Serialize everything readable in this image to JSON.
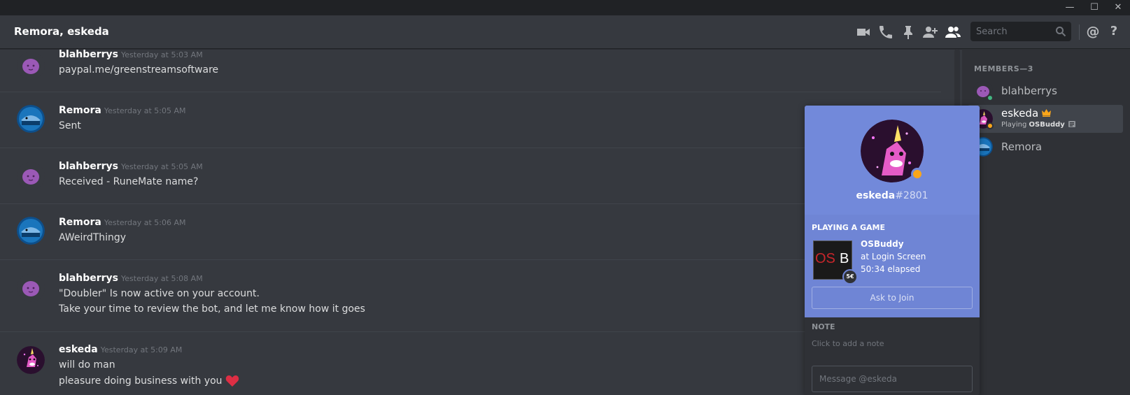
{
  "window": {
    "minimize_glyph": "—",
    "maximize_glyph": "☐",
    "close_glyph": "✕"
  },
  "header": {
    "title": "Remora, eskeda",
    "icons": [
      "video-icon",
      "phone-icon",
      "pin-icon",
      "add-member-icon",
      "members-icon",
      "mention-icon",
      "help-icon"
    ],
    "search_placeholder": "Search",
    "mention_glyph": "@",
    "help_glyph": "?"
  },
  "messages": [
    {
      "author": "blahberrys",
      "timestamp": "Yesterday at 5:03 AM",
      "lines": [
        "paypal.me/greenstreamsoftware"
      ]
    },
    {
      "author": "Remora",
      "timestamp": "Yesterday at 5:05 AM",
      "lines": [
        "Sent"
      ]
    },
    {
      "author": "blahberrys",
      "timestamp": "Yesterday at 5:05 AM",
      "lines": [
        "Received - RuneMate name?"
      ]
    },
    {
      "author": "Remora",
      "timestamp": "Yesterday at 5:06 AM",
      "lines": [
        "AWeirdThingy"
      ]
    },
    {
      "author": "blahberrys",
      "timestamp": "Yesterday at 5:08 AM",
      "lines": [
        "\"Doubler\" Is now active on your account.",
        "Take your time to review the bot, and let me know how it goes"
      ]
    },
    {
      "author": "eskeda",
      "timestamp": "Yesterday at 5:09 AM",
      "lines": [
        "will do man",
        "pleasure doing business with you"
      ]
    }
  ],
  "members": {
    "header": "MEMBERS—3",
    "list": [
      {
        "name": "blahberrys",
        "status_color": "#43b581"
      },
      {
        "name": "eskeda",
        "status_color": "#faa61a",
        "activity_prefix": "Playing",
        "activity_game": "OSBuddy",
        "owner_icon": "crown-icon"
      },
      {
        "name": "Remora"
      }
    ]
  },
  "popout": {
    "username": "eskeda",
    "discriminator": "#2801",
    "status_color": "#faa61a",
    "section_label": "PLAYING A GAME",
    "game_logo_left": "OS",
    "game_logo_right": "B",
    "game_badge": "5€",
    "game_title": "OSBuddy",
    "game_state": "at Login Screen",
    "game_elapsed": "50:34 elapsed",
    "join_button": "Ask to Join",
    "note_label": "NOTE",
    "note_placeholder": "Click to add a note",
    "message_placeholder": "Message @eskeda"
  },
  "colors": {
    "background": "#36393f",
    "sidebar": "#2f3136",
    "blurple": "#7289da",
    "idle": "#faa61a",
    "online": "#43b581",
    "heart": "#dd2e44"
  }
}
